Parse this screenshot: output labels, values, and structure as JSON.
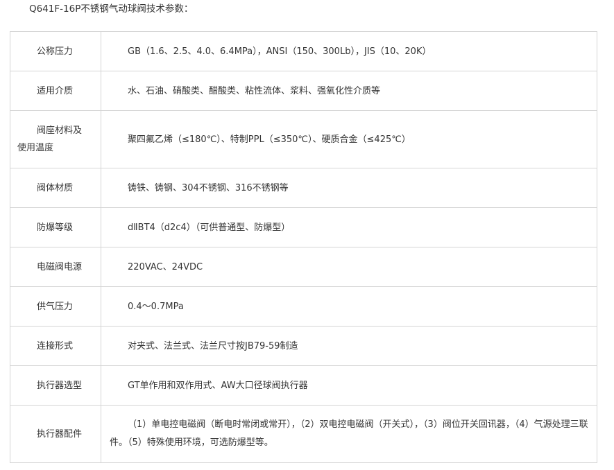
{
  "title": "Q641F-16P不锈钢气动球阀技术参数：",
  "rows": [
    {
      "label": "公称压力",
      "value": "GB（1.6、2.5、4.0、6.4MPa），ANSI（150、300Lb），JIS（10、20K）"
    },
    {
      "label": "适用介质",
      "value": "水、石油、硝酸类、醋酸类、粘性流体、浆料、强氧化性介质等"
    },
    {
      "label_line1": "阀座材料及",
      "label_line2": "使用温度",
      "value": "聚四氟乙烯（≤180℃）、特制PPL（≤350℃）、硬质合金（≤425℃）"
    },
    {
      "label": "阀体材质",
      "value": "铸铁、铸钢、304不锈钢、316不锈钢等"
    },
    {
      "label": "防爆等级",
      "value": "dⅡBT4（d2c4）（可供普通型、防爆型）"
    },
    {
      "label": "电磁阀电源",
      "value": "220VAC、24VDC"
    },
    {
      "label": "供气压力",
      "value": "0.4～0.7MPa"
    },
    {
      "label": "连接形式",
      "value": "对夹式、法兰式、法兰尺寸按JB79-59制造"
    },
    {
      "label": "执行器选型",
      "value": "GT单作用和双作用式、AW大口径球阀执行器"
    },
    {
      "label": "执行器配件",
      "value": "（1）单电控电磁阀（断电时常闭或常开），（2）双电控电磁阀（开关式），（3）阀位开关回讯器，（4）气源处理三联件。（5）特殊使用环境，可选防爆型等。"
    }
  ]
}
